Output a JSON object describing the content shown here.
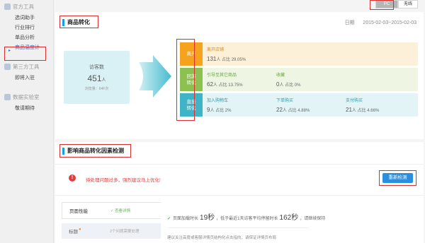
{
  "sidebar": {
    "groups": [
      {
        "label": "官方工具",
        "items": [
          "选词助手",
          "行业排行",
          "单品分析",
          "商品温度计"
        ]
      },
      {
        "label": "第三方工具",
        "items": [
          "即将入驻"
        ]
      },
      {
        "label": "数据实验室",
        "items": [
          "敬请期待"
        ]
      }
    ]
  },
  "header": {
    "pc_label": "PC",
    "wireless_label": "无线"
  },
  "conversion": {
    "title": "商品转化",
    "date_label": "日期",
    "date_range": "2015-02-03~2015-02-03",
    "visitor": {
      "label": "访客数",
      "value": "451",
      "unit": "人",
      "pv": "浏览量：64F次"
    },
    "rows": [
      {
        "tag_line1": "离开",
        "tag_line2": "",
        "tag_color": "#f7a21d",
        "bg": "#fdf0d8",
        "text_color": "#e38b10",
        "cells": [
          {
            "title": "离开店铺",
            "value": "131",
            "unit": "人",
            "pct": "占比 29.05%"
          }
        ]
      },
      {
        "tag_line1": "回游",
        "tag_line2": "转化",
        "tag_color": "#8cc152",
        "bg": "#eef6e3",
        "text_color": "#6aa435",
        "cells": [
          {
            "title": "引导至其它商品",
            "value": "62",
            "unit": "人",
            "pct": "占比 13.75%"
          },
          {
            "title": "收藏",
            "value": "0",
            "unit": "人",
            "pct": "占比 0%"
          }
        ]
      },
      {
        "tag_line1": "直接",
        "tag_line2": "转化",
        "tag_color": "#3fb4c7",
        "bg": "#e3f4f6",
        "text_color": "#2a9db0",
        "cells": [
          {
            "title": "加入购物车",
            "value": "9",
            "unit": "人",
            "pct": "占比 2%"
          },
          {
            "title": "下单购买",
            "value": "22",
            "unit": "人",
            "pct": "占比 4.88%"
          },
          {
            "title": "支付购买",
            "value": "21",
            "unit": "人",
            "pct": "占比 4.66%"
          }
        ]
      }
    ]
  },
  "factors": {
    "title": "影响商品转化因素检测",
    "alert": "待处理问题过多，强烈建议马上优化!",
    "recheck_label": "重新检测",
    "tabs": [
      {
        "label": "页面性能",
        "sub": "✓ 查看详情"
      },
      {
        "label": "标题",
        "sub": "2个问题需要处理"
      }
    ],
    "perf_pre": "页面加载时长",
    "perf_load": "19秒",
    "perf_mid": "，低于最近1天访客平均停留时长",
    "perf_stay": "162秒",
    "perf_post": "，请继续保持",
    "perf_note": "建议关注高度或客服详情页结构化点击指向，请保证详情页布局"
  }
}
